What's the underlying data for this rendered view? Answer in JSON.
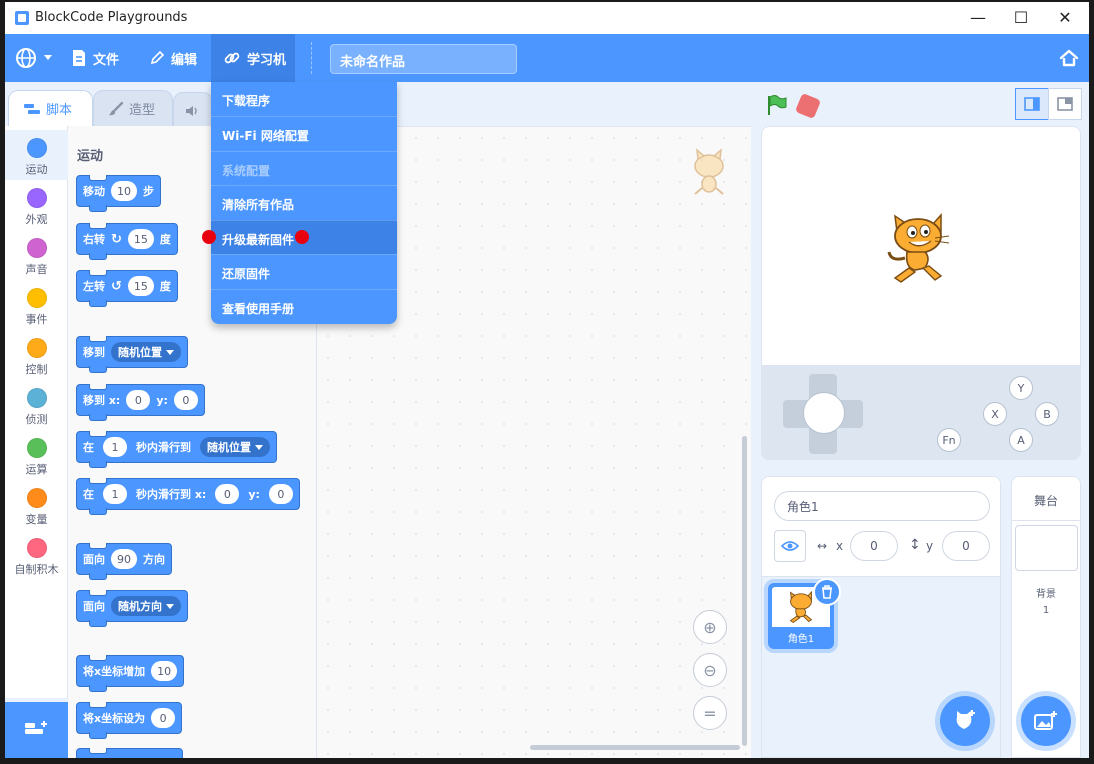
{
  "window": {
    "title": "BlockCode Playgrounds",
    "minimize": "—",
    "maximize": "☐",
    "close": "✕"
  },
  "menubar": {
    "file": "文件",
    "edit": "编辑",
    "learn": "学习机",
    "project_title": "未命名作品",
    "accent": "#4c97ff"
  },
  "dropdown": {
    "items": [
      {
        "label": "下载程序",
        "disabled": false
      },
      {
        "label": "Wi-Fi 网络配置",
        "disabled": false
      },
      {
        "label": "系统配置",
        "disabled": true
      },
      {
        "label": "清除所有作品",
        "disabled": false
      },
      {
        "label": "升级最新固件",
        "disabled": false,
        "highlighted": true
      },
      {
        "label": "还原固件",
        "disabled": false
      },
      {
        "label": "查看使用手册",
        "disabled": false
      }
    ]
  },
  "tabs": {
    "code": "脚本",
    "costumes": "造型"
  },
  "categories": [
    {
      "label": "运动",
      "color": "#4c97ff"
    },
    {
      "label": "外观",
      "color": "#9966ff"
    },
    {
      "label": "声音",
      "color": "#cf63cf"
    },
    {
      "label": "事件",
      "color": "#ffbf00"
    },
    {
      "label": "控制",
      "color": "#ffab19"
    },
    {
      "label": "侦测",
      "color": "#5cb1d6"
    },
    {
      "label": "运算",
      "color": "#59c059"
    },
    {
      "label": "变量",
      "color": "#ff8c1a"
    },
    {
      "label": "自制积木",
      "color": "#ff6680"
    }
  ],
  "palette": {
    "heading": "运动",
    "move": {
      "text": "移动",
      "value": "10",
      "unit": "步"
    },
    "turn_right": {
      "text": "右转",
      "value": "15",
      "unit": "度"
    },
    "turn_left": {
      "text": "左转",
      "value": "15",
      "unit": "度"
    },
    "goto": {
      "text": "移到",
      "option": "随机位置"
    },
    "goto_xy": {
      "text": "移到 x:",
      "x": "0",
      "y_label": "y:",
      "y": "0"
    },
    "glide": {
      "prefix": "在",
      "secs": "1",
      "text": "秒内滑行到",
      "option": "随机位置"
    },
    "glide_xy": {
      "prefix": "在",
      "secs": "1",
      "text": "秒内滑行到 x:",
      "x": "0",
      "y_label": "y:",
      "y": "0"
    },
    "point": {
      "text": "面向",
      "value": "90",
      "unit": "方向"
    },
    "point_towards": {
      "text": "面向",
      "option": "随机方向"
    },
    "change_x": {
      "text": "将x坐标增加",
      "value": "10"
    },
    "set_x": {
      "text": "将x坐标设为",
      "value": "0"
    }
  },
  "sprite": {
    "name": "角色1",
    "x_label": "x",
    "x": "0",
    "y_label": "y",
    "y": "0",
    "card_label": "角色1"
  },
  "stage_pane": {
    "title": "舞台",
    "backdrops_label": "背景",
    "backdrops_count": "1"
  },
  "gamepad": {
    "y": "Y",
    "x": "X",
    "b": "B",
    "a": "A",
    "fn": "Fn"
  }
}
